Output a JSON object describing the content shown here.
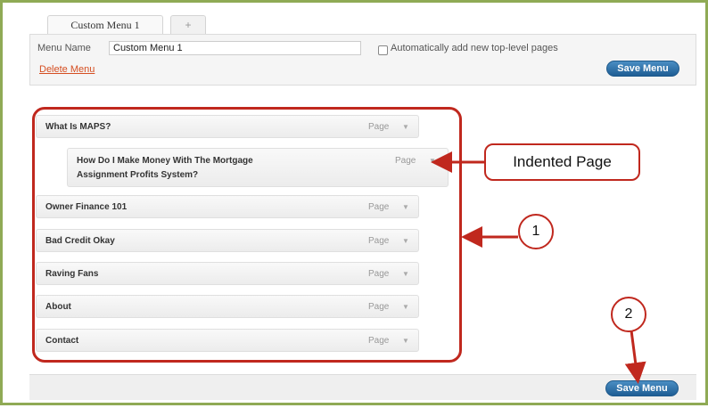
{
  "tabs": {
    "active": "Custom Menu 1",
    "add": "+"
  },
  "header": {
    "menu_name_label": "Menu Name",
    "menu_name_value": "Custom Menu 1",
    "auto_add_label": "Automatically add new top-level pages",
    "delete_label": "Delete Menu",
    "save_label": "Save Menu"
  },
  "items": [
    {
      "title": "What Is MAPS?",
      "type": "Page"
    },
    {
      "title_line1": "How Do I Make Money With The Mortgage",
      "title_line2": "Assignment Profits System?",
      "type": "Page"
    },
    {
      "title": "Owner Finance 101",
      "type": "Page"
    },
    {
      "title": "Bad Credit Okay",
      "type": "Page"
    },
    {
      "title": "Raving Fans",
      "type": "Page"
    },
    {
      "title": "About",
      "type": "Page"
    },
    {
      "title": "Contact",
      "type": "Page"
    }
  ],
  "footer": {
    "save_label": "Save Menu"
  },
  "annotations": {
    "indented_label": "Indented Page",
    "marker_1": "1",
    "marker_2": "2"
  },
  "colors": {
    "annotation_red": "#c0281e",
    "frame_green": "#8faa55",
    "button_blue": "#2a6fa8",
    "delete_red": "#d54e21"
  }
}
